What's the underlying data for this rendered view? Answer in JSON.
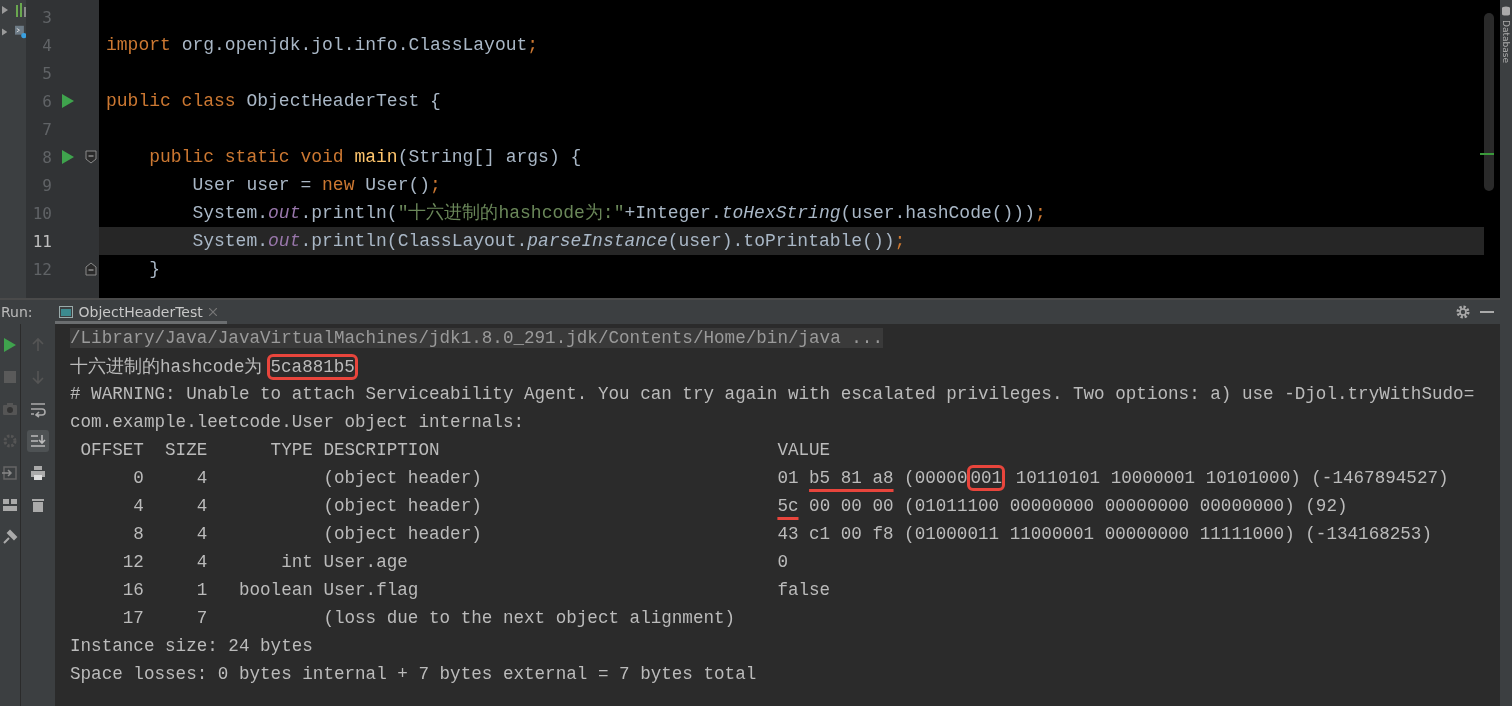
{
  "editor": {
    "lines": [
      {
        "number": "3",
        "current": false,
        "run": false,
        "fold_start": false,
        "fold_end": false
      },
      {
        "number": "4",
        "current": false,
        "run": false,
        "fold_start": false,
        "fold_end": false,
        "tokens": [
          {
            "text": "import ",
            "kind": "keyword"
          },
          {
            "text": "org.openjdk.jol.info.ClassLayout",
            "kind": "plain"
          },
          {
            "text": ";",
            "kind": "keyword"
          }
        ]
      },
      {
        "number": "5",
        "current": false,
        "run": false,
        "fold_start": false,
        "fold_end": false
      },
      {
        "number": "6",
        "current": false,
        "run": true,
        "fold_start": false,
        "fold_end": false,
        "tokens": [
          {
            "text": "public class ",
            "kind": "keyword"
          },
          {
            "text": "ObjectHeaderTest {",
            "kind": "plain"
          }
        ]
      },
      {
        "number": "7",
        "current": false,
        "run": false,
        "fold_start": false,
        "fold_end": false
      },
      {
        "number": "8",
        "current": false,
        "run": true,
        "fold_start": true,
        "fold_end": false,
        "tokens": [
          {
            "text": "    public static void ",
            "kind": "keyword"
          },
          {
            "text": "main",
            "kind": "method"
          },
          {
            "text": "(String[] args) {",
            "kind": "plain"
          }
        ]
      },
      {
        "number": "9",
        "current": false,
        "run": false,
        "fold_start": false,
        "fold_end": false,
        "tokens": [
          {
            "text": "        User user = ",
            "kind": "plain"
          },
          {
            "text": "new ",
            "kind": "keyword"
          },
          {
            "text": "User()",
            "kind": "plain"
          },
          {
            "text": ";",
            "kind": "keyword"
          }
        ]
      },
      {
        "number": "10",
        "current": false,
        "run": false,
        "fold_start": false,
        "fold_end": false,
        "tokens": [
          {
            "text": "        System.",
            "kind": "plain"
          },
          {
            "text": "out",
            "kind": "field"
          },
          {
            "text": ".println(",
            "kind": "plain"
          },
          {
            "text": "\"十六进制的hashcode为:\"",
            "kind": "string"
          },
          {
            "text": "+Integer.",
            "kind": "plain"
          },
          {
            "text": "toHexString",
            "kind": "static"
          },
          {
            "text": "(user.hashCode()))",
            "kind": "plain"
          },
          {
            "text": ";",
            "kind": "keyword"
          }
        ]
      },
      {
        "number": "11",
        "current": true,
        "run": false,
        "fold_start": false,
        "fold_end": false,
        "tokens": [
          {
            "text": "        System.",
            "kind": "plain"
          },
          {
            "text": "out",
            "kind": "field"
          },
          {
            "text": ".println(ClassLayout.",
            "kind": "plain"
          },
          {
            "text": "parseInstance",
            "kind": "static"
          },
          {
            "text": "(user).toPrintable())",
            "kind": "plain"
          },
          {
            "text": ";",
            "kind": "keyword"
          }
        ]
      },
      {
        "number": "12",
        "current": false,
        "run": false,
        "fold_start": false,
        "fold_end": true,
        "tokens": [
          {
            "text": "    }",
            "kind": "plain"
          }
        ]
      }
    ]
  },
  "right_strip": {
    "label": "Database"
  },
  "run_panel": {
    "title": "Run:",
    "tabs": [
      {
        "label": "ObjectHeaderTest",
        "selected": true
      }
    ],
    "console": [
      {
        "kind": "command",
        "segments": [
          {
            "text": "/Library/Java/JavaVirtualMachines/jdk1.8.0_291.jdk/Contents/Home/bin/java ...",
            "kind": "plain"
          }
        ]
      },
      {
        "kind": "output",
        "segments": [
          {
            "text": "十六进制的hashcode为",
            "kind": "plain"
          },
          {
            "text": "5ca881b5",
            "kind": "boxed"
          }
        ]
      },
      {
        "kind": "output",
        "segments": [
          {
            "text": "# WARNING: Unable to attach Serviceability Agent. You can try again with escalated privileges. Two options: a) use -Djol.tryWithSudo=",
            "kind": "plain"
          }
        ]
      },
      {
        "kind": "output",
        "segments": [
          {
            "text": "com.example.leetcode.User object internals:",
            "kind": "plain"
          }
        ]
      },
      {
        "kind": "output",
        "segments": [
          {
            "text": " OFFSET  SIZE      TYPE DESCRIPTION                                VALUE",
            "kind": "plain"
          }
        ]
      },
      {
        "kind": "output",
        "segments": [
          {
            "text": "      0     4           (object header)                            01 ",
            "kind": "plain"
          },
          {
            "text": "b5 81 a8",
            "kind": "underlined"
          },
          {
            "text": " (00000",
            "kind": "plain"
          },
          {
            "text": "001",
            "kind": "boxed"
          },
          {
            "text": " 10110101 10000001 10101000) (-1467894527)",
            "kind": "plain"
          }
        ]
      },
      {
        "kind": "output",
        "segments": [
          {
            "text": "      4     4           (object header)                            ",
            "kind": "plain"
          },
          {
            "text": "5c",
            "kind": "underlined"
          },
          {
            "text": " 00 00 00 (01011100 00000000 00000000 00000000) (92)",
            "kind": "plain"
          }
        ]
      },
      {
        "kind": "output",
        "segments": [
          {
            "text": "      8     4           (object header)                            43 c1 00 f8 (01000011 11000001 00000000 11111000) (-134168253)",
            "kind": "plain"
          }
        ]
      },
      {
        "kind": "output",
        "segments": [
          {
            "text": "     12     4       int User.age                                   0",
            "kind": "plain"
          }
        ]
      },
      {
        "kind": "output",
        "segments": [
          {
            "text": "     16     1   boolean User.flag                                  false",
            "kind": "plain"
          }
        ]
      },
      {
        "kind": "output",
        "segments": [
          {
            "text": "     17     7           (loss due to the next object alignment)",
            "kind": "plain"
          }
        ]
      },
      {
        "kind": "output",
        "segments": [
          {
            "text": "Instance size: 24 bytes",
            "kind": "plain"
          }
        ]
      },
      {
        "kind": "output",
        "segments": [
          {
            "text": "Space losses: 0 bytes internal + 7 bytes external = 7 bytes total",
            "kind": "plain"
          }
        ]
      }
    ]
  }
}
